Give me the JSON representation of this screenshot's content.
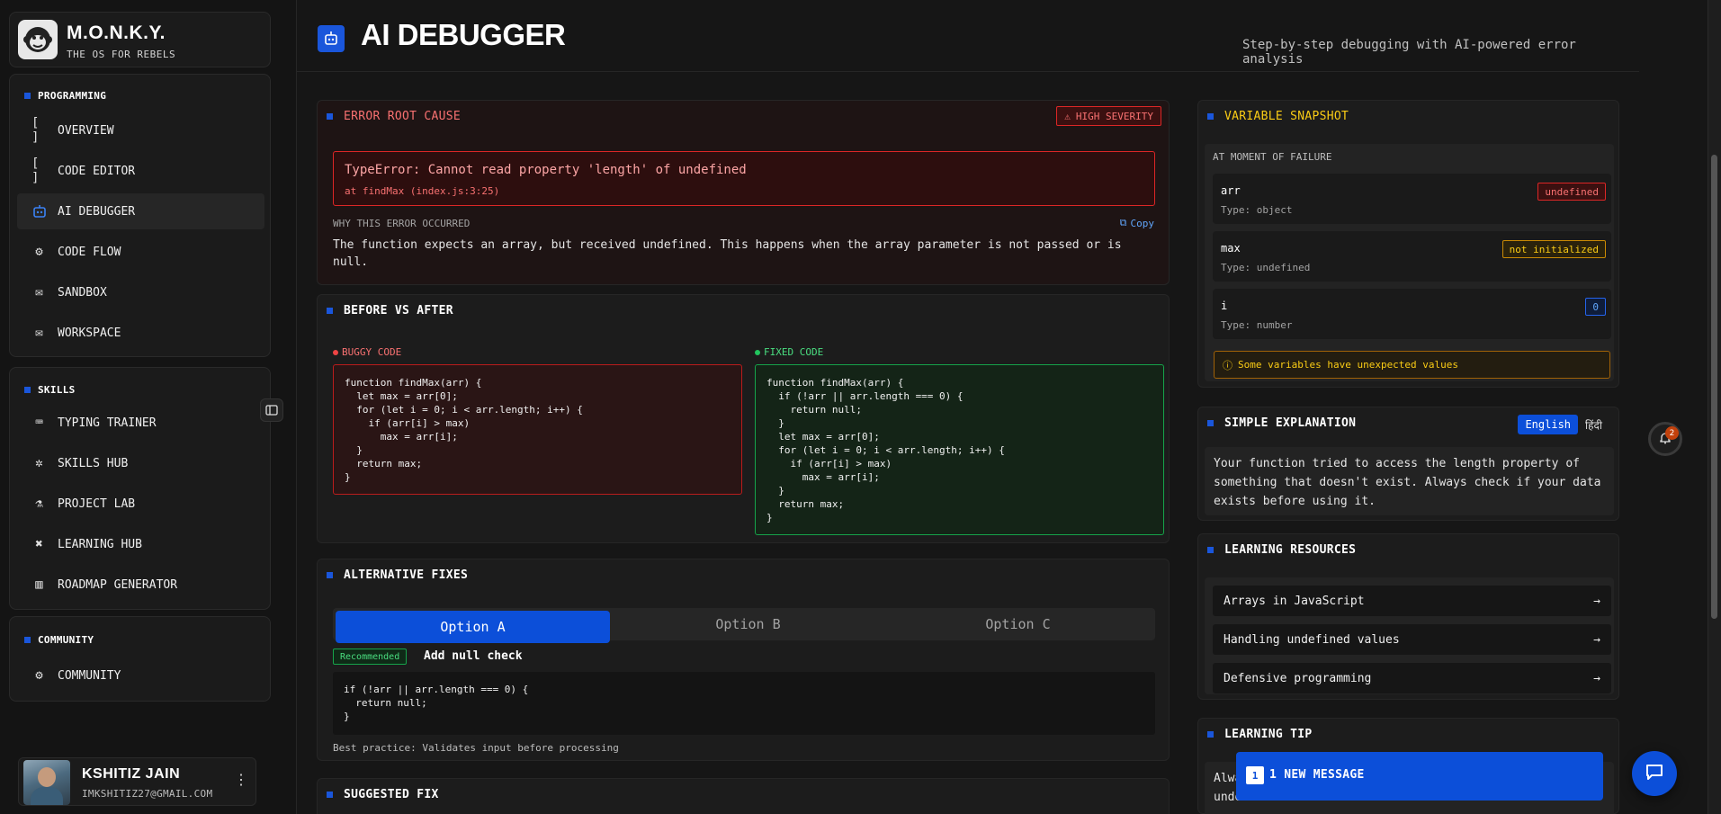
{
  "brand": {
    "title": "M.O.N.K.Y.",
    "subtitle": "THE OS FOR REBELS"
  },
  "nav": {
    "programming": {
      "heading": "PROGRAMMING",
      "items": [
        {
          "label": "OVERVIEW",
          "icon": "brackets-icon"
        },
        {
          "label": "CODE EDITOR",
          "icon": "brackets-icon"
        },
        {
          "label": "AI DEBUGGER",
          "icon": "bot-icon",
          "active": true
        },
        {
          "label": "CODE FLOW",
          "icon": "gear-icon"
        },
        {
          "label": "SANDBOX",
          "icon": "mail-icon"
        },
        {
          "label": "WORKSPACE",
          "icon": "mail-icon"
        }
      ]
    },
    "skills": {
      "heading": "SKILLS",
      "items": [
        {
          "label": "TYPING TRAINER",
          "icon": "keyboard-icon"
        },
        {
          "label": "SKILLS HUB",
          "icon": "badge-icon"
        },
        {
          "label": "PROJECT LAB",
          "icon": "flask-icon"
        },
        {
          "label": "LEARNING HUB",
          "icon": "network-icon"
        },
        {
          "label": "ROADMAP GENERATOR",
          "icon": "map-icon"
        }
      ]
    },
    "community": {
      "heading": "COMMUNITY",
      "items": [
        {
          "label": "COMMUNITY",
          "icon": "gear-icon"
        }
      ]
    }
  },
  "user": {
    "name": "KSHITIZ JAIN",
    "email": "IMKSHITIZ27@GMAIL.COM"
  },
  "header": {
    "title": "AI DEBUGGER",
    "subtitle": "Step-by-step debugging with AI-powered error analysis"
  },
  "error": {
    "title": "ERROR ROOT CAUSE",
    "severity": "HIGH SEVERITY",
    "message": "TypeError: Cannot read property 'length' of undefined",
    "location": "at findMax (index.js:3:25)",
    "why_label": "WHY THIS ERROR OCCURRED",
    "copy_label": "Copy",
    "why_text": "The function expects an array, but received undefined. This happens when the array parameter is not passed or is null."
  },
  "before_after": {
    "title": "BEFORE VS AFTER",
    "buggy_label": "BUGGY CODE",
    "fixed_label": "FIXED CODE",
    "buggy_code": "function findMax(arr) {\n  let max = arr[0];\n  for (let i = 0; i < arr.length; i++) {\n    if (arr[i] > max)\n      max = arr[i];\n  }\n  return max;\n}",
    "fixed_code": "function findMax(arr) {\n  if (!arr || arr.length === 0) {\n    return null;\n  }\n  let max = arr[0];\n  for (let i = 0; i < arr.length; i++) {\n    if (arr[i] > max)\n      max = arr[i];\n  }\n  return max;\n}"
  },
  "alternatives": {
    "title": "ALTERNATIVE FIXES",
    "options": [
      "Option A",
      "Option B",
      "Option C"
    ],
    "selected": "Option A",
    "badge": "Recommended",
    "fix_title": "Add null check",
    "code": "if (!arr || arr.length === 0) {\n  return null;\n}",
    "note": "Best practice: Validates input before processing"
  },
  "suggested": {
    "title": "SUGGESTED FIX"
  },
  "variables": {
    "title": "VARIABLE SNAPSHOT",
    "heading": "AT MOMENT OF FAILURE",
    "items": [
      {
        "name": "arr",
        "type": "Type: object",
        "value": "undefined"
      },
      {
        "name": "max",
        "type": "Type: undefined",
        "value": "not initialized"
      },
      {
        "name": "i",
        "type": "Type: number",
        "value": "0"
      }
    ],
    "warning": "Some variables have unexpected values"
  },
  "explanation": {
    "title": "SIMPLE EXPLANATION",
    "lang_en": "English",
    "lang_hi": "हिंदी",
    "text": "Your function tried to access the length property of something that doesn't exist. Always check if your data exists before using it."
  },
  "resources": {
    "title": "LEARNING RESOURCES",
    "items": [
      "Arrays in JavaScript",
      "Handling undefined values",
      "Defensive programming"
    ],
    "arrow": "→"
  },
  "tip": {
    "title": "LEARNING TIP",
    "text": "Always use default values or null checks to prevent undefined"
  },
  "notifications": {
    "count": "2"
  },
  "messages": {
    "count": "1",
    "label": "1 NEW MESSAGE"
  },
  "colors": {
    "accent": "#0c4fd9",
    "error": "#dc2626",
    "success": "#16a34a",
    "warning": "#facc15"
  }
}
